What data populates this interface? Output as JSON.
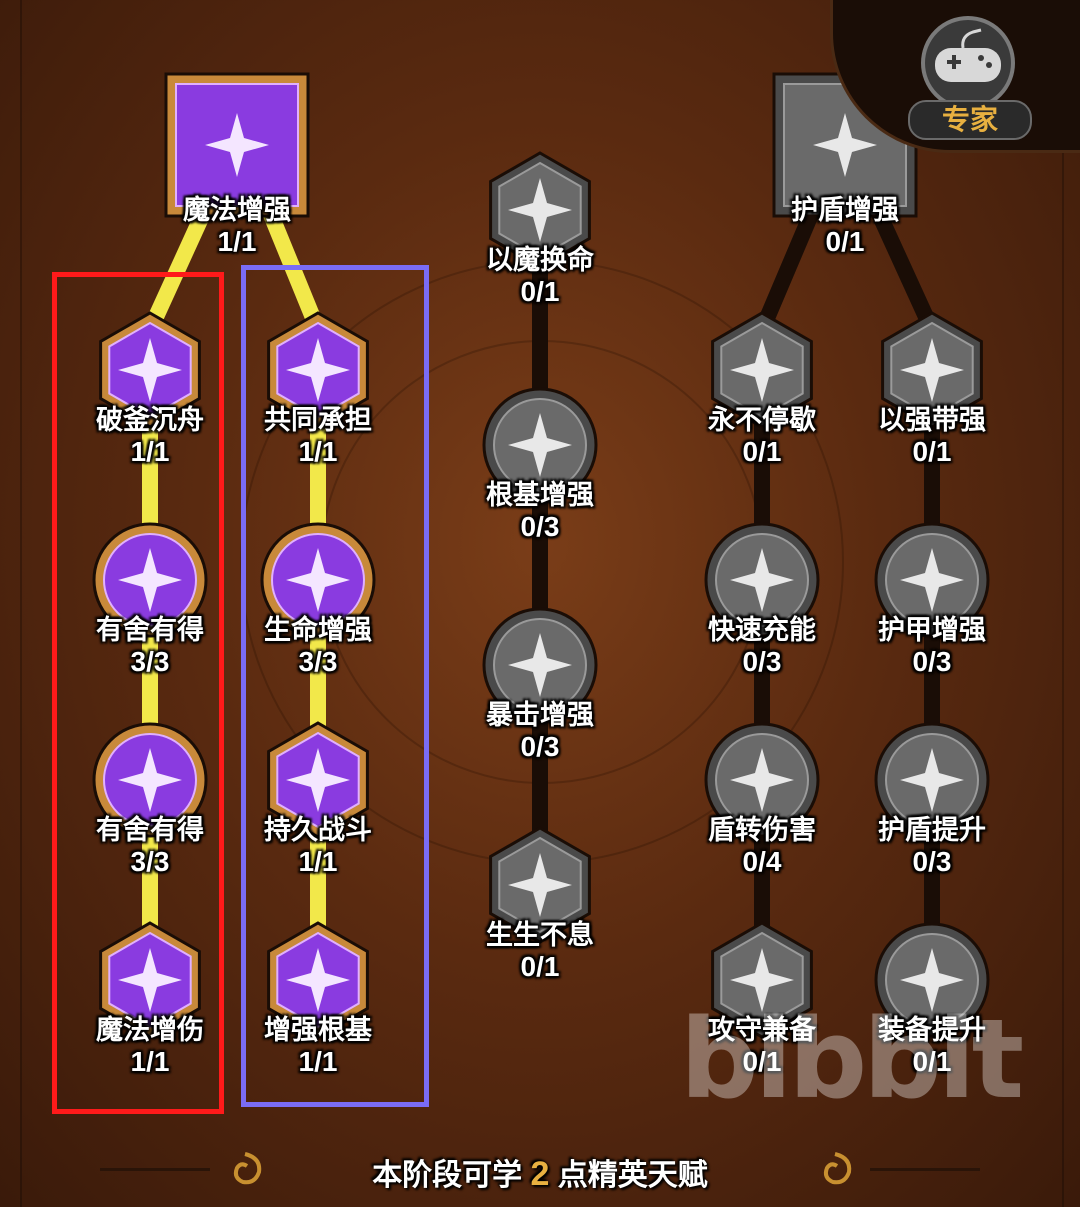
{
  "badge": {
    "label": "专家",
    "icon": "gamepad-icon"
  },
  "footer": {
    "prefix": "本阶段可学",
    "points": "2",
    "suffix": "点精英天赋"
  },
  "watermark": "bibbit",
  "colors": {
    "purple_active": "#8a3be0",
    "gray_locked": "#6a6a6a",
    "link_active": "#f2e84a",
    "highlight_red": "#ff1a1a",
    "highlight_blue": "#7a6cf5"
  },
  "tree": {
    "magic": {
      "label": "魔法增强",
      "count": "1/1",
      "icon": "star-burst-icon"
    },
    "left_col": [
      {
        "label": "破釜沉舟",
        "count": "1/1",
        "icon": "shield-star-icon"
      },
      {
        "label": "有舍有得",
        "count": "3/3",
        "icon": "compass-star-icon"
      },
      {
        "label": "有舍有得",
        "count": "3/3",
        "icon": "compass-plus-icon"
      },
      {
        "label": "魔法增伤",
        "count": "1/1",
        "icon": "sparkle-arrow-icon"
      }
    ],
    "mid_col": [
      {
        "label": "共同承担",
        "count": "1/1",
        "icon": "heart-icon"
      },
      {
        "label": "生命增强",
        "count": "3/3",
        "icon": "heart-plus-icon"
      },
      {
        "label": "持久战斗",
        "count": "1/1",
        "icon": "star-heart-icon"
      },
      {
        "label": "增强根基",
        "count": "1/1",
        "icon": "lightning-icon"
      }
    ],
    "center_col": [
      {
        "label": "以魔换命",
        "count": "0/1",
        "icon": "heart-broken-icon"
      },
      {
        "label": "根基增强",
        "count": "0/3",
        "icon": "spikes-icon"
      },
      {
        "label": "暴击增强",
        "count": "0/3",
        "icon": "sword-burst-icon"
      },
      {
        "label": "生生不息",
        "count": "0/1",
        "icon": "demon-mask-icon"
      }
    ],
    "shield": {
      "label": "护盾增强",
      "count": "0/1",
      "icon": "shield-arrow-icon"
    },
    "right_a": [
      {
        "label": "永不停歇",
        "count": "0/1",
        "icon": "shield-star-icon"
      },
      {
        "label": "快速充能",
        "count": "0/3",
        "icon": "compass-star-icon"
      },
      {
        "label": "盾转伤害",
        "count": "0/4",
        "icon": "compass-plus-icon"
      },
      {
        "label": "攻守兼备",
        "count": "0/1",
        "icon": "sparkle-shield-icon"
      }
    ],
    "right_b": [
      {
        "label": "以强带强",
        "count": "0/1",
        "icon": "shield-plus-icon"
      },
      {
        "label": "护甲增强",
        "count": "0/3",
        "icon": "claw-icon"
      },
      {
        "label": "护盾提升",
        "count": "0/3",
        "icon": "shield-up-icon"
      },
      {
        "label": "装备提升",
        "count": "0/1",
        "icon": "helmet-icon"
      }
    ]
  }
}
